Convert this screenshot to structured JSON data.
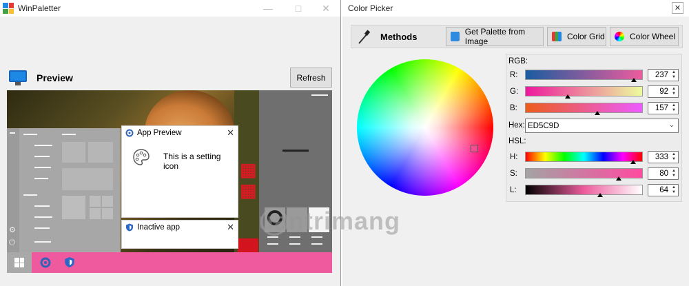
{
  "left_window": {
    "title": "WinPaletter",
    "minimize_icon": "minimize-icon",
    "maximize_icon": "maximize-icon",
    "close_icon": "close-icon",
    "section_title": "Preview",
    "refresh_label": "Refresh",
    "preview": {
      "notification1": {
        "title": "App Preview",
        "body": "This is a setting icon"
      },
      "notification2": {
        "title": "Inactive app"
      },
      "taskbar_color": "#ef5a9e"
    }
  },
  "right_window": {
    "title": "Color Picker",
    "close_label": "✕",
    "methods": {
      "title": "Methods",
      "buttons": [
        "Get Palette from Image",
        "Color Grid",
        "Color Wheel"
      ]
    },
    "rgb_label": "RGB:",
    "hsl_label": "HSL:",
    "hex_label": "Hex:",
    "hex_value": "ED5C9D",
    "channels": {
      "r": {
        "label": "R:",
        "value": "237",
        "fraction": 0.929
      },
      "g": {
        "label": "G:",
        "value": "92",
        "fraction": 0.361
      },
      "b": {
        "label": "B:",
        "value": "157",
        "fraction": 0.616
      },
      "h": {
        "label": "H:",
        "value": "333",
        "fraction": 0.925
      },
      "s": {
        "label": "S:",
        "value": "80",
        "fraction": 0.8
      },
      "l": {
        "label": "L:",
        "value": "64",
        "fraction": 0.64
      }
    },
    "selected_color": "#ED5C9D"
  },
  "watermark": "uantrimang"
}
